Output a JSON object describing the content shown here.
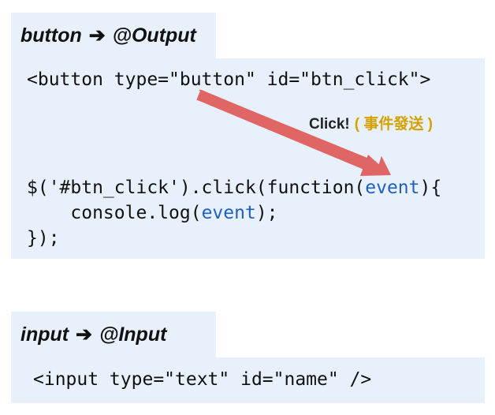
{
  "output_section": {
    "tab_left": "button",
    "tab_arrow": "➔",
    "tab_right": "@Output",
    "code_line1": "<button type=\"button\" id=\"btn_click\">",
    "code_line2_prefix": "$('#btn_click').click(function(",
    "code_line2_event": "event",
    "code_line2_suffix": "){",
    "code_line3_prefix": "    console.log(",
    "code_line3_event": "event",
    "code_line3_suffix": ");",
    "code_line4": "});",
    "click_text": "Click!",
    "click_note": "( 事件發送 )"
  },
  "input_section": {
    "tab_left": "input",
    "tab_arrow": "➔",
    "tab_right": "@Input",
    "code_line1": "<input type=\"text\" id=\"name\" />"
  },
  "colors": {
    "panel_bg": "#e8f1fb",
    "arrow": "#e06666",
    "event_keyword": "#1f5fbf",
    "note": "#d4a100"
  }
}
